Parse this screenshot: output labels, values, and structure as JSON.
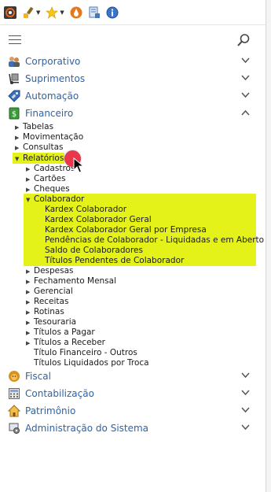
{
  "toolbar": {
    "icons": [
      "app-logo-icon",
      "brush-icon",
      "star-icon",
      "drop-icon",
      "report-icon",
      "info-icon"
    ]
  },
  "menu": {
    "sections_top": [
      {
        "label": "Corporativo",
        "icon": "people-icon"
      },
      {
        "label": "Suprimentos",
        "icon": "handtruck-icon"
      },
      {
        "label": "Automação",
        "icon": "tag-icon"
      },
      {
        "label": "Financeiro",
        "icon": "money-icon"
      }
    ],
    "financeiro": {
      "items": [
        "Tabelas",
        "Movimentação",
        "Consultas"
      ],
      "relatorios": "Relatórios",
      "rel_items": [
        "Cadastros",
        "Cartões",
        "Cheques"
      ],
      "colaborador": "Colaborador",
      "colab_items": [
        "Kardex Colaborador",
        "Kardex Colaborador Geral",
        "Kardex Colaborador Geral por Empresa",
        "Pendências de Colaborador - Liquidadas e em Aberto",
        "Saldo de Colaboradores",
        "Títulos Pendentes de Colaborador"
      ],
      "rel_items_after": [
        "Despesas",
        "Fechamento Mensal",
        "Gerencial",
        "Receitas",
        "Rotinas",
        "Tesouraria",
        "Títulos a Pagar",
        "Títulos a Receber"
      ],
      "rel_leaf_items": [
        "Título Financeiro - Outros",
        "Títulos Liquidados por Troca"
      ]
    },
    "sections_bottom": [
      {
        "label": "Fiscal",
        "icon": "lion-icon"
      },
      {
        "label": "Contabilização",
        "icon": "calculator-icon"
      },
      {
        "label": "Patrimônio",
        "icon": "house-icon"
      },
      {
        "label": "Administração do Sistema",
        "icon": "admin-icon"
      }
    ]
  },
  "colors": {
    "accent": "#2d63a6",
    "highlight": "#e4f21a",
    "cursor": "#e8384b"
  }
}
